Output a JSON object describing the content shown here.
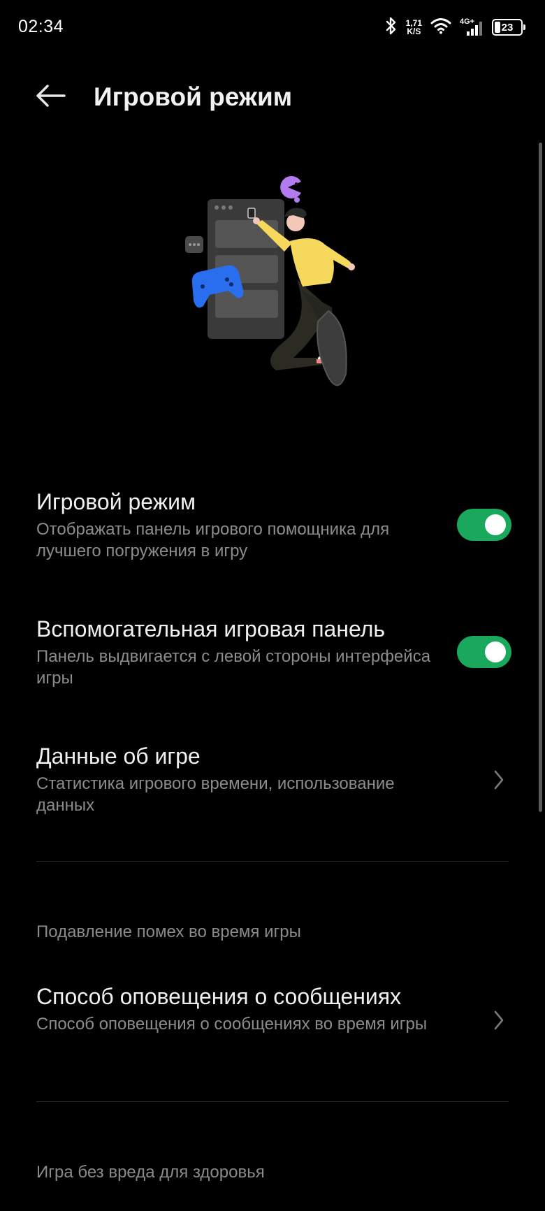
{
  "status_bar": {
    "time": "02:34",
    "net_speed_value": "1,71",
    "net_speed_unit": "K/S",
    "network": "4G+",
    "battery": "23"
  },
  "header": {
    "title": "Игровой режим",
    "back_icon": "arrow-left-icon"
  },
  "settings": [
    {
      "title": "Игровой режим",
      "description": "Отображать панель игрового помощника для лучшего погружения в игру",
      "control": "toggle",
      "on": true
    },
    {
      "title": "Вспомогательная игровая панель",
      "description": "Панель выдвигается с левой стороны интерфейса игры",
      "control": "toggle",
      "on": true
    },
    {
      "title": "Данные об игре",
      "description": "Статистика игрового времени, использование данных",
      "control": "chevron"
    }
  ],
  "sections": [
    {
      "header": "Подавление помех во время игры",
      "items": [
        {
          "title": "Способ оповещения о сообщениях",
          "description": "Способ оповещения о сообщениях во время игры",
          "control": "chevron"
        }
      ]
    },
    {
      "header": "Игра без вреда для здоровья",
      "items": []
    }
  ],
  "colors": {
    "background": "#000000",
    "toggle_on": "#1aa85c",
    "secondary_text": "#8c8c8c"
  }
}
